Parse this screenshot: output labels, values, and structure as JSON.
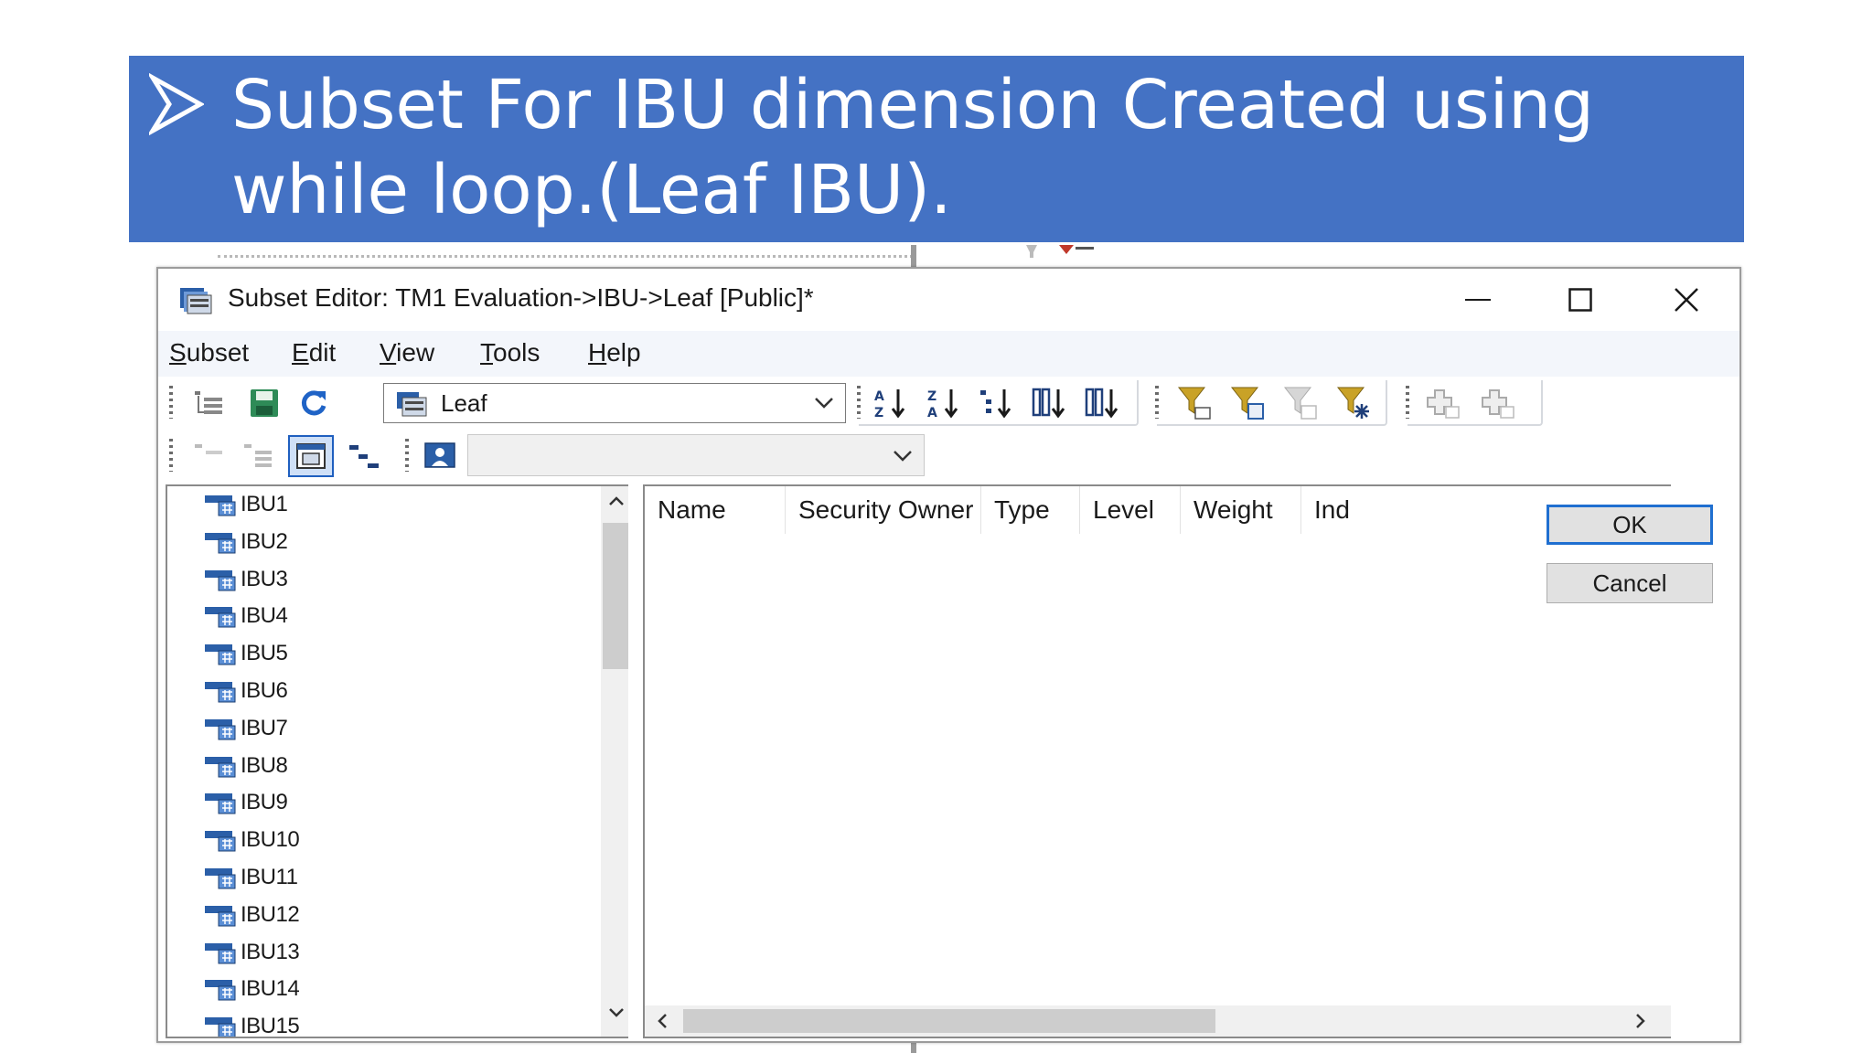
{
  "slide": {
    "title": "Subset For IBU dimension Created using while loop.(Leaf IBU)."
  },
  "window": {
    "title": "Subset Editor:  TM1 Evaluation->IBU->Leaf  [Public]*",
    "controls": [
      "minimize",
      "maximize",
      "close"
    ]
  },
  "menu": [
    {
      "label": "Subset",
      "mnemonic": "S"
    },
    {
      "label": "Edit",
      "mnemonic": "E"
    },
    {
      "label": "View",
      "mnemonic": "V"
    },
    {
      "label": "Tools",
      "mnemonic": "T"
    },
    {
      "label": "Help",
      "mnemonic": "H"
    }
  ],
  "toolbar": {
    "subset_select": "Leaf",
    "alias_select": ""
  },
  "elements": [
    "IBU1",
    "IBU2",
    "IBU3",
    "IBU4",
    "IBU5",
    "IBU6",
    "IBU7",
    "IBU8",
    "IBU9",
    "IBU10",
    "IBU11",
    "IBU12",
    "IBU13",
    "IBU14",
    "IBU15"
  ],
  "grid": {
    "columns": [
      "Name",
      "Security Owner",
      "Type",
      "Level",
      "Weight",
      "Ind"
    ]
  },
  "buttons": {
    "ok": "OK",
    "cancel": "Cancel"
  },
  "colors": {
    "banner": "#4472c4",
    "default_button_border": "#1f6fd0"
  }
}
